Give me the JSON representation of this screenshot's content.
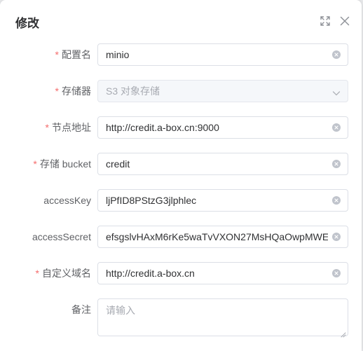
{
  "dialog": {
    "title": "修改"
  },
  "form": {
    "required_mark": "*",
    "fields": [
      {
        "label": "配置名",
        "value": "minio",
        "required": true
      },
      {
        "label": "存储器",
        "value": "S3 对象存储",
        "required": true
      },
      {
        "label": "节点地址",
        "value": "http://credit.a-box.cn:9000",
        "required": true
      },
      {
        "label": "存储 bucket",
        "value": "credit",
        "required": true
      },
      {
        "label": "accessKey",
        "value": "ljPfID8PStzG3jlphlec",
        "required": false
      },
      {
        "label": "accessSecret",
        "value": "efsgslvHAxM6rKe5waTvVXON27MsHQaOwpMWE",
        "required": false
      },
      {
        "label": "自定义域名",
        "value": "http://credit.a-box.cn",
        "required": true
      },
      {
        "label": "备注",
        "placeholder": "请输入",
        "required": false
      }
    ]
  },
  "icons": {
    "fullscreen": "fullscreen-icon",
    "close": "close-icon",
    "clear": "clear-icon",
    "dropdown": "chevron-down-icon"
  },
  "colors": {
    "required": "#f56c6c",
    "border": "#dcdfe6",
    "placeholder": "#a8abb2",
    "disabled_bg": "#f5f7fa"
  }
}
